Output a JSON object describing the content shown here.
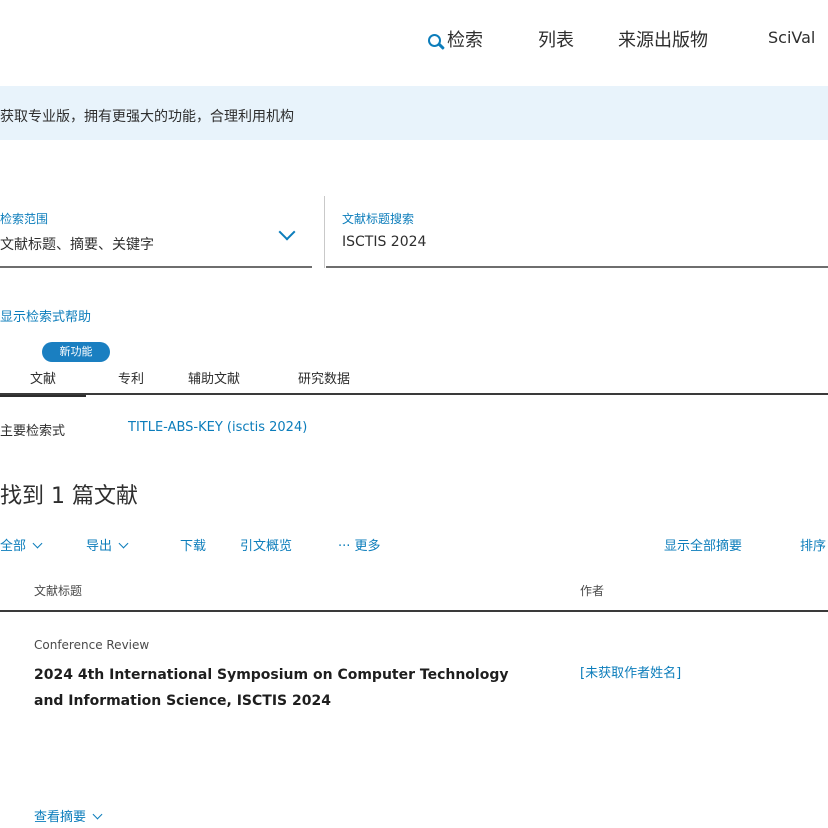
{
  "nav": {
    "search_label": "检索",
    "lists_label": "列表",
    "sources_label": "来源出版物",
    "scival_label": "SciVal"
  },
  "banner": {
    "text": "获取专业版，拥有更强大的功能，合理利用机构"
  },
  "search_form": {
    "field_label": "检索范围",
    "field_value": "文献标题、摘要、关键字",
    "query_label": "文献标题搜索",
    "query_value": "ISCTIS 2024"
  },
  "advanced_link": "显示检索式帮助",
  "tabs": {
    "badge": "新功能",
    "items": [
      "文献",
      "专利",
      "辅助文献",
      "研究数据"
    ]
  },
  "query_summary": {
    "label": "主要检索式",
    "value": "TITLE-ABS-KEY (isctis 2024)"
  },
  "results": {
    "heading": "找到 1 篇文献",
    "toolbar": {
      "select_all": "全部",
      "export": "导出",
      "download": "下载",
      "cite": "引文概览",
      "more": "更多",
      "show_abstract": "显示全部摘要",
      "sort": "排序"
    },
    "columns": {
      "title": "文献标题",
      "authors": "作者"
    },
    "rows": [
      {
        "type": "Conference Review",
        "title": "2024 4th International Symposium on Computer Technology and Information Science, ISCTIS 2024",
        "authors": "[未获取作者姓名]",
        "abstract_label": "查看摘要"
      }
    ]
  },
  "colors": {
    "accent": "#0c7dbb",
    "banner": "#e8f3fb",
    "badge": "#1a7fc1"
  }
}
